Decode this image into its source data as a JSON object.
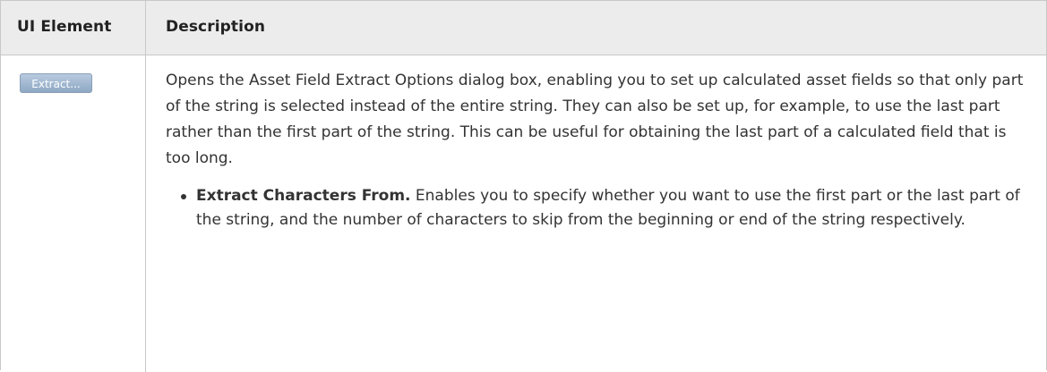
{
  "table": {
    "headers": {
      "ui_element": "UI Element",
      "description": "Description"
    },
    "row": {
      "button_label": "Extract...",
      "description": "Opens the Asset Field Extract Options dialog box, enabling you to set up calculated asset fields so that only part of the string is selected instead of the entire string. They can also be set up, for example, to use the last part rather than the first part of the string. This can be useful for obtaining the last part of a calculated field that is too long.",
      "bullets": [
        {
          "term": "Extract Characters From.",
          "text": " Enables you to specify whether you want to use the first part or the last part of the string, and the number of characters to skip from the beginning or end of the string respectively."
        }
      ]
    }
  }
}
